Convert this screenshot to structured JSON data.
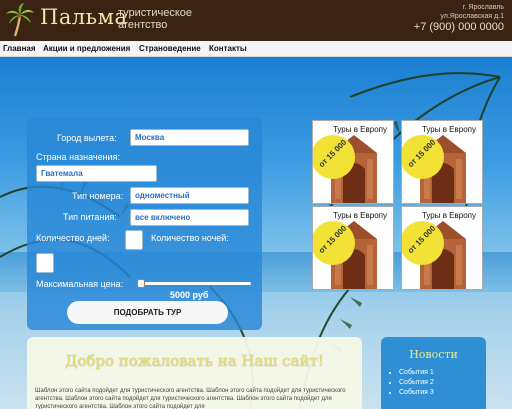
{
  "header": {
    "logo": "Пальма",
    "tagline_1": "туристическое",
    "tagline_2": "агентство",
    "city": "г. Ярославль",
    "address": "ул.Ярославская д.1",
    "phone": "+7 (900) 000 0000"
  },
  "nav": [
    "Главная",
    "Акции и предложения",
    "Страноведение",
    "Контакты"
  ],
  "form": {
    "departure_label": "Город вылета:",
    "departure_value": "Москва",
    "destination_label": "Страна назначения:",
    "destination_value": "Гватемала",
    "room_label": "Тип номера:",
    "room_value": "одноместный",
    "meal_label": "Тип питания:",
    "meal_value": "все включено",
    "days_label": "Количество дней:",
    "nights_label": "Количество ночей:",
    "max_price_label": "Максимальная цена:",
    "max_price_value": "5000 руб",
    "submit": "ПОДОБРАТЬ ТУР"
  },
  "tours": [
    {
      "title": "Туры в Европу",
      "badge": "от 15 000"
    },
    {
      "title": "Туры в Европу",
      "badge": "от 15 000"
    },
    {
      "title": "Туры в Европу",
      "badge": "от 15 000"
    },
    {
      "title": "Туры в Европу",
      "badge": "от 15 000"
    }
  ],
  "welcome": {
    "title": "Добро пожаловать на Наш сайт!",
    "text": "Шаблон этого сайта подойдет для туристического агентства. Шаблон этого сайта подойдет для туристического агентства. Шаблон этого сайта подойдет для туристического агентства. Шаблон этого сайта подойдет для туристического агентства. Шаблон этого сайта подойдет для"
  },
  "news": {
    "title": "Новости",
    "items": [
      "События 1",
      "События 2",
      "События 3"
    ]
  },
  "colors": {
    "header_bg": "#3b2313",
    "form_bg": "#2887d7",
    "badge": "#f3e236",
    "news_bg": "#2f8fd4"
  }
}
